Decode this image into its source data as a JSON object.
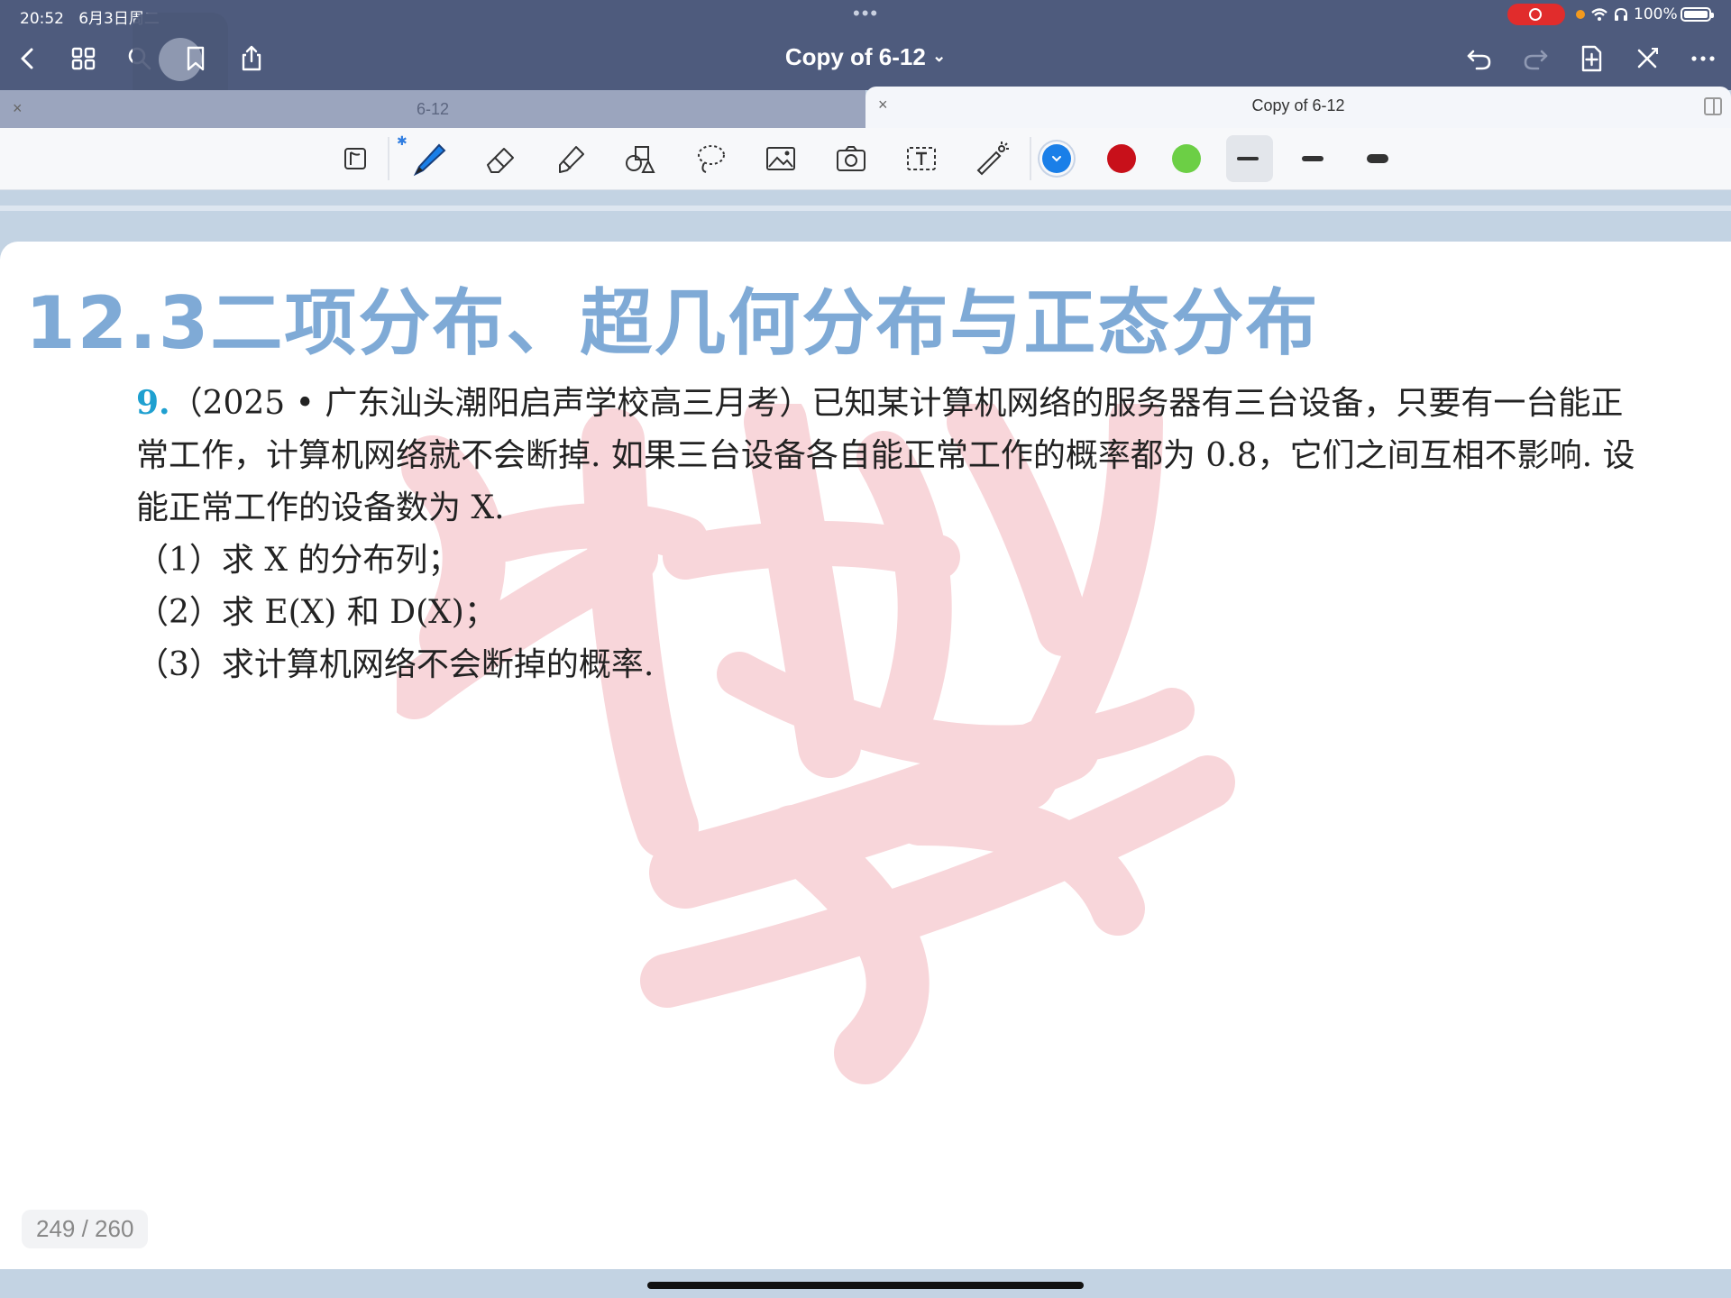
{
  "status_bar": {
    "time": "20:52",
    "date": "6月3日周二",
    "dots": "•••",
    "battery": "100%"
  },
  "nav": {
    "doc_title": "Copy of 6-12",
    "title_chevron": "⌄"
  },
  "tabs": [
    {
      "label": "6-12",
      "active": false,
      "close": "×"
    },
    {
      "label": "Copy of 6-12",
      "active": true,
      "close": "×"
    }
  ],
  "toolbar": {
    "tools": [
      "read-mode-icon",
      "pen-icon",
      "eraser-icon",
      "highlighter-icon",
      "shapes-icon",
      "lasso-icon",
      "image-icon",
      "camera-icon",
      "text-box-icon",
      "laser-pointer-icon"
    ],
    "bluetooth_mark": "✱",
    "colors": [
      "#1a7fe8",
      "#c8101a",
      "#6ccf45"
    ],
    "selected_color": "#1a7fe8",
    "widths": [
      "thin",
      "medium",
      "thick"
    ],
    "selected_width": "thin"
  },
  "page": {
    "chapter_heading": "12.3二项分布、超几何分布与正态分布",
    "problem": {
      "number": "9.",
      "source": "（2025 • 广东汕头潮阳启声学校高三月考）",
      "stem": "已知某计算机网络的服务器有三台设备，只要有一台能正常工作，计算机网络就不会断掉. 如果三台设备各自能正常工作的概率都为 0.8，它们之间互相不影响. 设能正常工作的设备数为 X.",
      "parts": [
        "（1）求 X 的分布列；",
        "（2）求 E(X) 和 D(X)；",
        "（3）求计算机网络不会断掉的概率."
      ]
    },
    "page_indicator": "249 / 260"
  }
}
